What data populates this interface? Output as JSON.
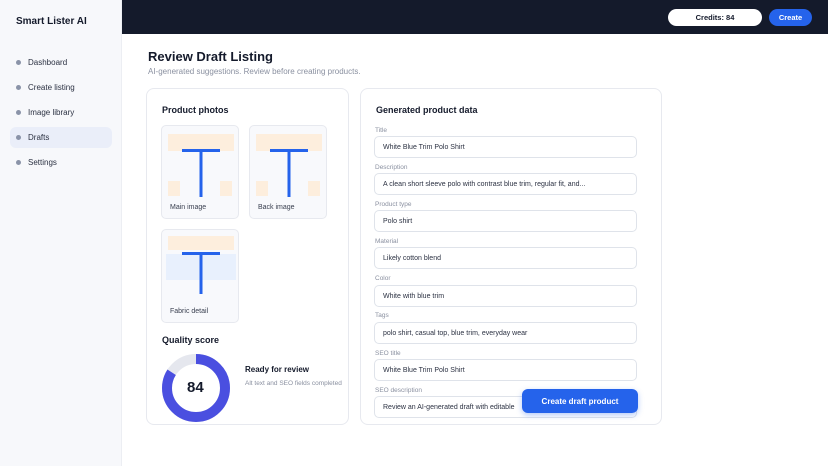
{
  "app": {
    "name": "Smart Lister AI"
  },
  "sidebar": {
    "items": [
      {
        "label": "Dashboard"
      },
      {
        "label": "Create listing"
      },
      {
        "label": "Image library"
      },
      {
        "label": "Drafts"
      },
      {
        "label": "Settings"
      }
    ],
    "active_index": 3
  },
  "topbar": {
    "credits_label": "Credits: 84",
    "create_label": "Create"
  },
  "page": {
    "title": "Review Draft Listing",
    "subtitle": "AI-generated suggestions. Review before creating products."
  },
  "photos": {
    "title": "Product photos",
    "items": [
      {
        "label": "Main image"
      },
      {
        "label": "Back image"
      },
      {
        "label": "Fabric detail"
      }
    ]
  },
  "quality": {
    "title": "Quality score",
    "score": "84",
    "score_fraction": 0.84,
    "status": "Ready for review",
    "detail": "Alt text and SEO fields completed"
  },
  "generated": {
    "title": "Generated product data",
    "fields": [
      {
        "label": "Title",
        "value": "White Blue Trim Polo Shirt"
      },
      {
        "label": "Description",
        "value": "A clean short sleeve polo with contrast blue trim, regular fit, and..."
      },
      {
        "label": "Product type",
        "value": "Polo shirt"
      },
      {
        "label": "Material",
        "value": "Likely cotton blend"
      },
      {
        "label": "Color",
        "value": "White with blue trim"
      },
      {
        "label": "Tags",
        "value": "polo shirt, casual top, blue trim, everyday wear"
      },
      {
        "label": "SEO title",
        "value": "White Blue Trim Polo Shirt"
      },
      {
        "label": "SEO description",
        "value": "Review an AI-generated draft with editable"
      }
    ],
    "cta_label": "Create draft product"
  },
  "colors": {
    "accent": "#2563eb",
    "topbar": "#141a2b",
    "ring_bg": "#e5e7ee"
  }
}
